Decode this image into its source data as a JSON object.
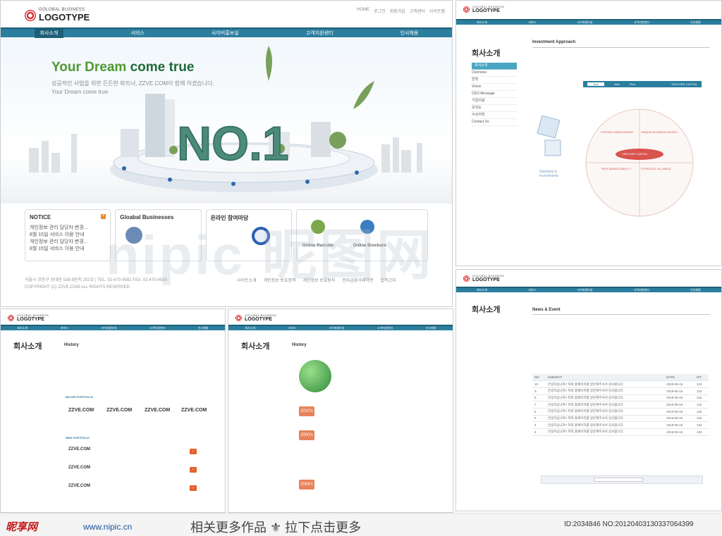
{
  "brand": {
    "tagline": "GOLOBAL BUSINESS",
    "name": "LOGOTYPE"
  },
  "top_nav": [
    "HOME",
    "로그인",
    "회원가입",
    "고객센터",
    "사이트맵"
  ],
  "menu": [
    "회사소개",
    "서비스",
    "사이버홍보실",
    "고객지원센터",
    "인사채용"
  ],
  "hero": {
    "title_a": "Your Dream ",
    "title_b": "come true",
    "sub1": "성공적인 사업을 위한 든든한 파트너, ZZVE.COM이 함께 하겠습니다.",
    "sub2": "Your Dream come true",
    "badge": "NO.1"
  },
  "notice": {
    "title": "NOTICE",
    "items": [
      "개인정보 관리 담당자 변경...",
      "8월 15일 서비스 이용 안내",
      "개인정보 관리 담당자 변경...",
      "8월 15일 서비스 이용 안내"
    ]
  },
  "boxes": {
    "global": "Gloabal Businesses",
    "consult": "온라인 참여마당",
    "recruit": "Online Recruite",
    "brochure": "Online Brochure"
  },
  "footer": {
    "address": "서울시 강동구 성내동 538-8번지 202호 | TEL. 02-470-4582 FAX. 02-470-4583",
    "copy": "COPYRIGHT (C) ZZVE.COM ALL RIGHTS RESERVED",
    "links": [
      "사이트소개",
      "개인정보 보호정책",
      "개인정보 보호원칙",
      "전자금융거래약관",
      "법적고지"
    ]
  },
  "sub_pages": {
    "company_title": "회사소개",
    "side_items": [
      "회사소개",
      "Overview",
      "연혁",
      "Vision",
      "CEO Message",
      "기업이념",
      "조직도",
      "수상이력",
      "Contact Us"
    ],
    "investment": "Investment Approach",
    "news": "News & Event",
    "history": "History",
    "venture": "VENTURE CAPITAL",
    "std_inv": "Standard & Investments",
    "strong": "STRONG MANAGEMENT",
    "unique": "UNIQUE BUSINESS MODEL",
    "strategy": "STRATEGIC ALLIANCE",
    "true_mkt": "TRUE MARKETABILITY",
    "major": "MAJOR PORTFOLIO",
    "newp": "NEW PORTFOLIO",
    "zzve": "ZZVE.COM",
    "years": [
      "2010's",
      "2000's",
      "2008's"
    ],
    "tabs": [
      "Asia",
      "Now",
      "Flow"
    ]
  },
  "news_table": {
    "headers": [
      "NO",
      "SUBJECT",
      "DATE",
      "HIT"
    ],
    "rows": [
      [
        "10",
        "안녕하십니까? 저희 홈페이지를 방문해주셔서 감사합니다.",
        "2019-06-16",
        "122"
      ],
      [
        "9",
        "안녕하십니까? 저희 홈페이지를 방문해주셔서 감사합니다.",
        "2019-06-16",
        "122"
      ],
      [
        "8",
        "안녕하십니까? 저희 홈페이지를 방문해주셔서 감사합니다.",
        "2019-06-16",
        "122"
      ],
      [
        "7",
        "안녕하십니까? 저희 홈페이지를 방문해주셔서 감사합니다.",
        "2019-06-16",
        "122"
      ],
      [
        "6",
        "안녕하십니까? 저희 홈페이지를 방문해주셔서 감사합니다.",
        "2019-06-16",
        "122"
      ],
      [
        "5",
        "안녕하십니까? 저희 홈페이지를 방문해주셔서 감사합니다.",
        "2019-06-16",
        "122"
      ],
      [
        "4",
        "안녕하십니까? 저희 홈페이지를 방문해주셔서 감사합니다.",
        "2019-06-16",
        "122"
      ],
      [
        "3",
        "안녕하십니까? 저희 홈페이지를 방문해주셔서 감사합니다.",
        "2019-06-16",
        "122"
      ]
    ]
  },
  "watermark": "nipic 昵图网",
  "bottom": {
    "site": "昵享网",
    "url": "www.nipic.cn",
    "more": "相关更多作品  ⚜  拉下点击更多",
    "id": "ID:2034846 NO:20120403130337064399"
  },
  "colors": {
    "accent": "#2b7e9e",
    "green": "#4f9a32",
    "orange": "#e3632d"
  }
}
